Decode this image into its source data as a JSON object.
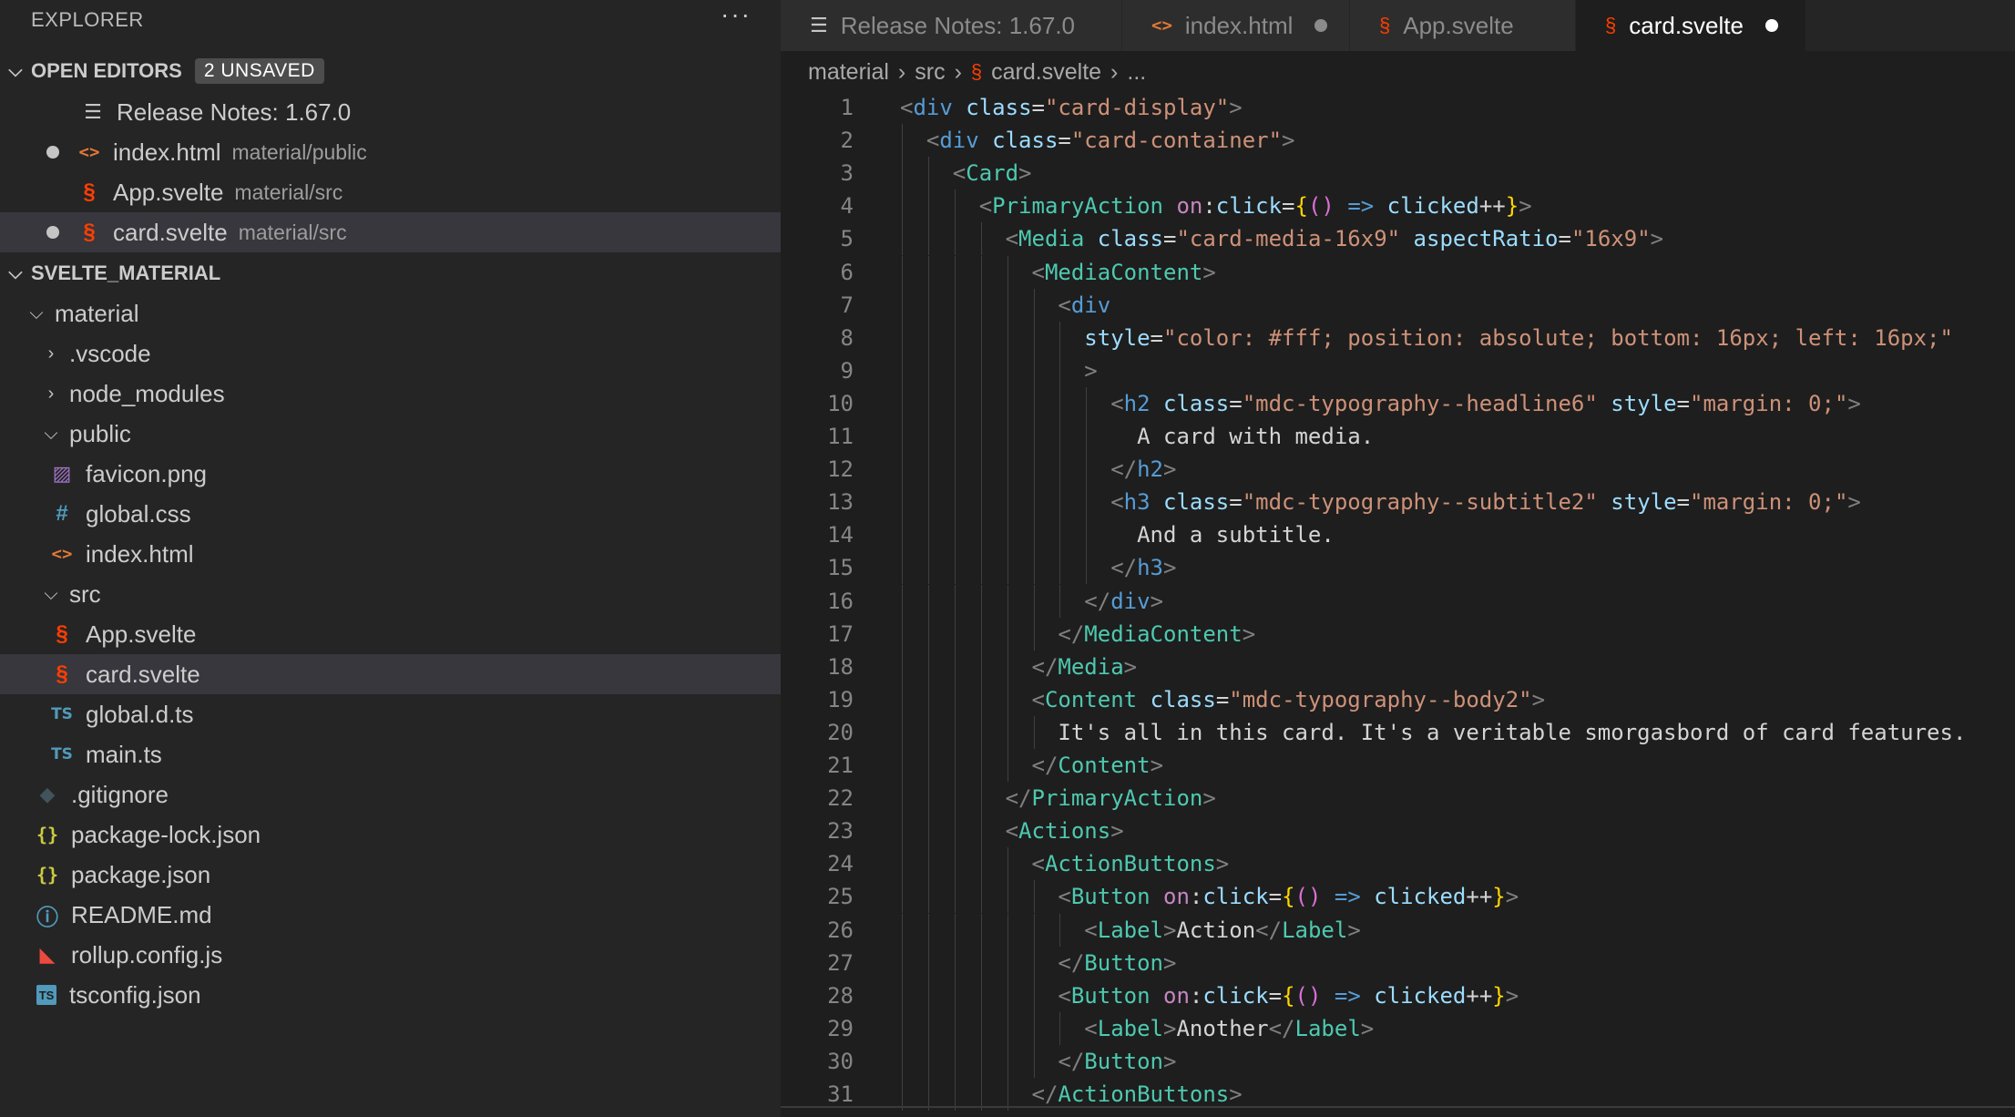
{
  "sidebar": {
    "title": "EXPLORER",
    "more": "···",
    "open_editors": {
      "label": "OPEN EDITORS",
      "badge": "2 UNSAVED",
      "items": [
        {
          "name": "Release Notes: 1.67.0",
          "desc": ""
        },
        {
          "name": "index.html",
          "desc": "material/public"
        },
        {
          "name": "App.svelte",
          "desc": "material/src"
        },
        {
          "name": "card.svelte",
          "desc": "material/src"
        }
      ]
    },
    "workspace": {
      "label": "SVELTE_MATERIAL",
      "items": [
        "material",
        ".vscode",
        "node_modules",
        "public",
        "favicon.png",
        "global.css",
        "index.html",
        "src",
        "App.svelte",
        "card.svelte",
        "global.d.ts",
        "main.ts",
        ".gitignore",
        "package-lock.json",
        "package.json",
        "README.md",
        "rollup.config.js",
        "tsconfig.json"
      ]
    }
  },
  "tabs": [
    {
      "label": "Release Notes: 1.67.0"
    },
    {
      "label": "index.html"
    },
    {
      "label": "App.svelte"
    },
    {
      "label": "card.svelte"
    }
  ],
  "breadcrumb": [
    "material",
    "src",
    "card.svelte",
    "..."
  ],
  "colors": {
    "accent": "#569cd6",
    "svelte": "#ff3e00",
    "html": "#e37933"
  },
  "code": {
    "line_numbers": [
      "1",
      "2",
      "3",
      "4",
      "5",
      "6",
      "7",
      "8",
      "9",
      "10",
      "11",
      "12",
      "13",
      "14",
      "15",
      "16",
      "17",
      "18",
      "19",
      "20",
      "21",
      "22",
      "23",
      "24",
      "25",
      "26",
      "27",
      "28",
      "29",
      "30",
      "31"
    ],
    "lines": [
      [
        [
          "t-punc",
          "<"
        ],
        [
          "t-tag",
          "div"
        ],
        [
          "t-text",
          " "
        ],
        [
          "t-attr",
          "class"
        ],
        [
          "t-text",
          "="
        ],
        [
          "t-str",
          "\"card-display\""
        ],
        [
          "t-punc",
          ">"
        ]
      ],
      [
        [
          "t-punc",
          "<"
        ],
        [
          "t-tag",
          "div"
        ],
        [
          "t-text",
          " "
        ],
        [
          "t-attr",
          "class"
        ],
        [
          "t-text",
          "="
        ],
        [
          "t-str",
          "\"card-container\""
        ],
        [
          "t-punc",
          ">"
        ]
      ],
      [
        [
          "t-punc",
          "<"
        ],
        [
          "t-comp",
          "Card"
        ],
        [
          "t-punc",
          ">"
        ]
      ],
      [
        [
          "t-punc",
          "<"
        ],
        [
          "t-comp",
          "PrimaryAction"
        ],
        [
          "t-text",
          " "
        ],
        [
          "t-ns",
          "on"
        ],
        [
          "t-text",
          ":"
        ],
        [
          "t-attr",
          "click"
        ],
        [
          "t-text",
          "="
        ],
        [
          "t-brace",
          "{"
        ],
        [
          "t-paren",
          "()"
        ],
        [
          "t-text",
          " "
        ],
        [
          "t-arrow",
          "=>"
        ],
        [
          "t-text",
          " "
        ],
        [
          "t-var",
          "clicked"
        ],
        [
          "t-text",
          "++"
        ],
        [
          "t-brace",
          "}"
        ],
        [
          "t-punc",
          ">"
        ]
      ],
      [
        [
          "t-punc",
          "<"
        ],
        [
          "t-comp",
          "Media"
        ],
        [
          "t-text",
          " "
        ],
        [
          "t-attr",
          "class"
        ],
        [
          "t-text",
          "="
        ],
        [
          "t-str",
          "\"card-media-16x9\""
        ],
        [
          "t-text",
          " "
        ],
        [
          "t-attr",
          "aspectRatio"
        ],
        [
          "t-text",
          "="
        ],
        [
          "t-str",
          "\"16x9\""
        ],
        [
          "t-punc",
          ">"
        ]
      ],
      [
        [
          "t-punc",
          "<"
        ],
        [
          "t-comp",
          "MediaContent"
        ],
        [
          "t-punc",
          ">"
        ]
      ],
      [
        [
          "t-punc",
          "<"
        ],
        [
          "t-tag",
          "div"
        ]
      ],
      [
        [
          "t-attr",
          "style"
        ],
        [
          "t-text",
          "="
        ],
        [
          "t-str",
          "\"color: #fff; position: absolute; bottom: 16px; left: 16px;\""
        ]
      ],
      [
        [
          "t-punc",
          ">"
        ]
      ],
      [
        [
          "t-punc",
          "<"
        ],
        [
          "t-tag",
          "h2"
        ],
        [
          "t-text",
          " "
        ],
        [
          "t-attr",
          "class"
        ],
        [
          "t-text",
          "="
        ],
        [
          "t-str",
          "\"mdc-typography--headline6\""
        ],
        [
          "t-text",
          " "
        ],
        [
          "t-attr",
          "style"
        ],
        [
          "t-text",
          "="
        ],
        [
          "t-str",
          "\"margin: 0;\""
        ],
        [
          "t-punc",
          ">"
        ]
      ],
      [
        [
          "t-text",
          "A card with media."
        ]
      ],
      [
        [
          "t-punc",
          "</"
        ],
        [
          "t-tag",
          "h2"
        ],
        [
          "t-punc",
          ">"
        ]
      ],
      [
        [
          "t-punc",
          "<"
        ],
        [
          "t-tag",
          "h3"
        ],
        [
          "t-text",
          " "
        ],
        [
          "t-attr",
          "class"
        ],
        [
          "t-text",
          "="
        ],
        [
          "t-str",
          "\"mdc-typography--subtitle2\""
        ],
        [
          "t-text",
          " "
        ],
        [
          "t-attr",
          "style"
        ],
        [
          "t-text",
          "="
        ],
        [
          "t-str",
          "\"margin: 0;\""
        ],
        [
          "t-punc",
          ">"
        ]
      ],
      [
        [
          "t-text",
          "And a subtitle."
        ]
      ],
      [
        [
          "t-punc",
          "</"
        ],
        [
          "t-tag",
          "h3"
        ],
        [
          "t-punc",
          ">"
        ]
      ],
      [
        [
          "t-punc",
          "</"
        ],
        [
          "t-tag",
          "div"
        ],
        [
          "t-punc",
          ">"
        ]
      ],
      [
        [
          "t-punc",
          "</"
        ],
        [
          "t-comp",
          "MediaContent"
        ],
        [
          "t-punc",
          ">"
        ]
      ],
      [
        [
          "t-punc",
          "</"
        ],
        [
          "t-comp",
          "Media"
        ],
        [
          "t-punc",
          ">"
        ]
      ],
      [
        [
          "t-punc",
          "<"
        ],
        [
          "t-comp",
          "Content"
        ],
        [
          "t-text",
          " "
        ],
        [
          "t-attr",
          "class"
        ],
        [
          "t-text",
          "="
        ],
        [
          "t-str",
          "\"mdc-typography--body2\""
        ],
        [
          "t-punc",
          ">"
        ]
      ],
      [
        [
          "t-text",
          "It's all in this card. It's a veritable smorgasbord of card features."
        ]
      ],
      [
        [
          "t-punc",
          "</"
        ],
        [
          "t-comp",
          "Content"
        ],
        [
          "t-punc",
          ">"
        ]
      ],
      [
        [
          "t-punc",
          "</"
        ],
        [
          "t-comp",
          "PrimaryAction"
        ],
        [
          "t-punc",
          ">"
        ]
      ],
      [
        [
          "t-punc",
          "<"
        ],
        [
          "t-comp",
          "Actions"
        ],
        [
          "t-punc",
          ">"
        ]
      ],
      [
        [
          "t-punc",
          "<"
        ],
        [
          "t-comp",
          "ActionButtons"
        ],
        [
          "t-punc",
          ">"
        ]
      ],
      [
        [
          "t-punc",
          "<"
        ],
        [
          "t-comp",
          "Button"
        ],
        [
          "t-text",
          " "
        ],
        [
          "t-ns",
          "on"
        ],
        [
          "t-text",
          ":"
        ],
        [
          "t-attr",
          "click"
        ],
        [
          "t-text",
          "="
        ],
        [
          "t-brace",
          "{"
        ],
        [
          "t-paren",
          "()"
        ],
        [
          "t-text",
          " "
        ],
        [
          "t-arrow",
          "=>"
        ],
        [
          "t-text",
          " "
        ],
        [
          "t-var",
          "clicked"
        ],
        [
          "t-text",
          "++"
        ],
        [
          "t-brace",
          "}"
        ],
        [
          "t-punc",
          ">"
        ]
      ],
      [
        [
          "t-punc",
          "<"
        ],
        [
          "t-comp",
          "Label"
        ],
        [
          "t-punc",
          ">"
        ],
        [
          "t-text",
          "Action"
        ],
        [
          "t-punc",
          "</"
        ],
        [
          "t-comp",
          "Label"
        ],
        [
          "t-punc",
          ">"
        ]
      ],
      [
        [
          "t-punc",
          "</"
        ],
        [
          "t-comp",
          "Button"
        ],
        [
          "t-punc",
          ">"
        ]
      ],
      [
        [
          "t-punc",
          "<"
        ],
        [
          "t-comp",
          "Button"
        ],
        [
          "t-text",
          " "
        ],
        [
          "t-ns",
          "on"
        ],
        [
          "t-text",
          ":"
        ],
        [
          "t-attr",
          "click"
        ],
        [
          "t-text",
          "="
        ],
        [
          "t-brace",
          "{"
        ],
        [
          "t-paren",
          "()"
        ],
        [
          "t-text",
          " "
        ],
        [
          "t-arrow",
          "=>"
        ],
        [
          "t-text",
          " "
        ],
        [
          "t-var",
          "clicked"
        ],
        [
          "t-text",
          "++"
        ],
        [
          "t-brace",
          "}"
        ],
        [
          "t-punc",
          ">"
        ]
      ],
      [
        [
          "t-punc",
          "<"
        ],
        [
          "t-comp",
          "Label"
        ],
        [
          "t-punc",
          ">"
        ],
        [
          "t-text",
          "Another"
        ],
        [
          "t-punc",
          "</"
        ],
        [
          "t-comp",
          "Label"
        ],
        [
          "t-punc",
          ">"
        ]
      ],
      [
        [
          "t-punc",
          "</"
        ],
        [
          "t-comp",
          "Button"
        ],
        [
          "t-punc",
          ">"
        ]
      ],
      [
        [
          "t-punc",
          "</"
        ],
        [
          "t-comp",
          "ActionButtons"
        ],
        [
          "t-punc",
          ">"
        ]
      ]
    ]
  }
}
